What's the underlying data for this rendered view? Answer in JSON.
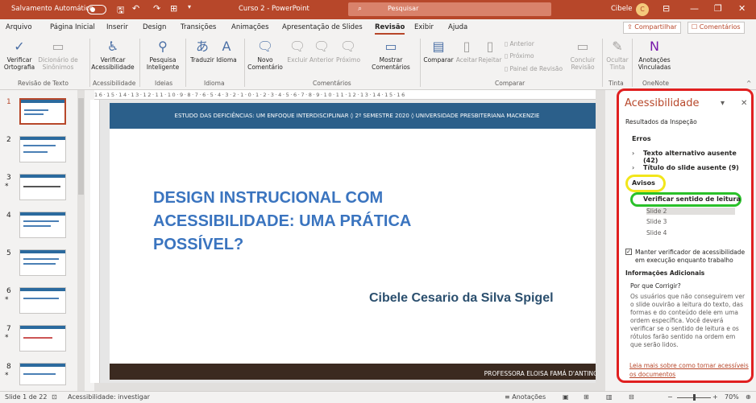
{
  "titlebar": {
    "autosave": "Salvamento Automático",
    "doc": "Curso 2 - PowerPoint",
    "search": "Pesquisar",
    "user": "Cibele",
    "initial": "C"
  },
  "menu": [
    "Arquivo",
    "Página Inicial",
    "Inserir",
    "Design",
    "Transições",
    "Animações",
    "Apresentação de Slides",
    "Revisão",
    "Exibir",
    "Ajuda"
  ],
  "menu_active": "Revisão",
  "share": "Compartilhar",
  "comments": "Comentários",
  "ribbon": {
    "verificar": "Verificar Ortografia",
    "dicionario": "Dicionário de Sinônimos",
    "g1": "Revisão de Texto",
    "acessibilidade": "Verificar Acessibilidade",
    "g2": "Acessibilidade",
    "pesquisa": "Pesquisa Inteligente",
    "g3": "Ideias",
    "traduzir": "Traduzir",
    "idioma": "Idioma",
    "g4": "Idioma",
    "novo": "Novo Comentário",
    "excluir": "Excluir",
    "anterior": "Anterior",
    "proximo": "Próximo",
    "mostrar": "Mostrar Comentários",
    "g5": "Comentários",
    "comparar": "Comparar",
    "aceitar": "Aceitar",
    "rejeitar": "Rejeitar",
    "anterior2": "Anterior",
    "proximo2": "Próximo",
    "painel": "Painel de Revisão",
    "concluir": "Concluir Revisão",
    "g6": "Comparar",
    "ocultar": "Ocultar Tinta",
    "g7": "Tinta",
    "anotacoes": "Anotações Vinculadas",
    "g8": "OneNote"
  },
  "ruler": "16·15·14·13·12·11·10·9·8·7·6·5·4·3·2·1·0·1·2·3·4·5·6·7·8·9·10·11·12·13·14·15·16",
  "slide": {
    "header": "ESTUDO DAS DEFICIÊNCIAS: UM ENFOQUE INTERDISCIPLINAR ◊ 2º SEMESTRE 2020 ◊ UNIVERSIDADE PRESBITERIANA MACKENZIE",
    "title": "DESIGN INSTRUCIONAL COM ACESSIBILIDADE: UMA PRÁTICA POSSÍVEL?",
    "author": "Cibele Cesario da Silva Spigel",
    "footer": "PROFESSORA ELOISA FAMÁ D'ANTINO"
  },
  "thumbs": [
    "1",
    "2",
    "3",
    "4",
    "5",
    "6",
    "7",
    "8"
  ],
  "panel": {
    "title": "Acessibilidade",
    "results": "Resultados da Inspeção",
    "erros": "Erros",
    "e1": "Texto alternativo ausente (42)",
    "e2": "Título do slide ausente (9)",
    "avisos": "Avisos",
    "a1": "Verificar sentido de leitura",
    "slides": [
      "Slide 2",
      "Slide 3",
      "Slide 4"
    ],
    "manter": "Manter verificador de acessibilidade em execução enquanto trabalho",
    "info": "Informações Adicionais",
    "porque": "Por que Corrigir?",
    "desc": "Os usuários que não conseguirem ver o slide ouvirão a leitura do texto, das formas e do conteúdo dele em uma ordem específica. Você deverá verificar se o sentido de leitura e os rótulos farão sentido na ordem em que serão lidos.",
    "leia": "Leia mais sobre como tornar acessíveis os documentos"
  },
  "status": {
    "slide": "Slide 1 de 22",
    "acc": "Acessibilidade: investigar",
    "notes": "Anotações",
    "zoom": "70%"
  },
  "colors": {
    "accent": "#b7472a",
    "slide_band": "#2b5f8a"
  }
}
